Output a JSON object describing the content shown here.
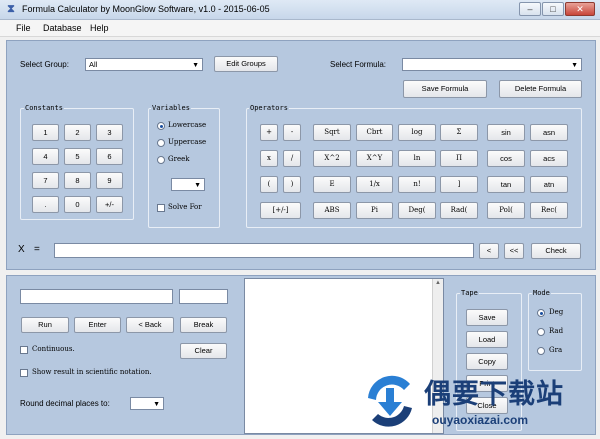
{
  "window": {
    "title": "Formula Calculator by MoonGlow Software, v1.0  -  2015-06-05",
    "icon": "hourglass-icon",
    "minimize": "–",
    "maximize": "□",
    "close": "✕"
  },
  "menu": [
    "File",
    "Database",
    "Help"
  ],
  "top": {
    "select_group_label": "Select Group:",
    "select_group_value": "All",
    "edit_groups": "Edit Groups",
    "select_formula_label": "Select Formula:",
    "select_formula_value": "",
    "save_formula": "Save Formula",
    "delete_formula": "Delete Formula"
  },
  "constants": {
    "title": "Constants",
    "rows": [
      [
        "1",
        "2",
        "3"
      ],
      [
        "4",
        "5",
        "6"
      ],
      [
        "7",
        "8",
        "9"
      ],
      [
        ".",
        "0",
        "+/-"
      ]
    ]
  },
  "variables": {
    "title": "Variables",
    "options": [
      "Lowercase",
      "Uppercase",
      "Greek"
    ],
    "selected": 0,
    "dropdown_value": "",
    "solve_for": "Solve For"
  },
  "operators": {
    "title": "Operators",
    "rows": [
      [
        "+",
        "-",
        "Sqrt",
        "Cbrt",
        "log",
        "Σ",
        "sin",
        "asn"
      ],
      [
        "x",
        "/",
        "X^2",
        "X^Y",
        "ln",
        "Π",
        "cos",
        "acs"
      ],
      [
        "(",
        ")",
        "E",
        "1/x",
        "n!",
        "]",
        "tan",
        "atn"
      ],
      [
        "[+/-]",
        "ABS",
        "Pi",
        "Deg(",
        "Rad(",
        "Pol(",
        "Rec("
      ]
    ]
  },
  "xrow": {
    "label": "X",
    "equals": "=",
    "value": "",
    "back": "<",
    "back_all": "<<",
    "check": "Check"
  },
  "bottom": {
    "input1": "",
    "input2": "",
    "run": "Run",
    "enter": "Enter",
    "back": "< Back",
    "break": "Break",
    "continuous": "Continuous.",
    "clear": "Clear",
    "scientific": "Show result in scientific notation.",
    "round_label": "Round decimal places to:",
    "round_value": ""
  },
  "tape": {
    "title": "Tape",
    "buttons": [
      "Save",
      "Load",
      "Copy",
      "Print",
      "Close"
    ]
  },
  "mode": {
    "title": "Mode",
    "options": [
      "Deg",
      "Rad",
      "Gra"
    ],
    "selected": 0
  },
  "watermark": {
    "title": "偶要下载站",
    "url": "ouyaoxiazai.com"
  }
}
